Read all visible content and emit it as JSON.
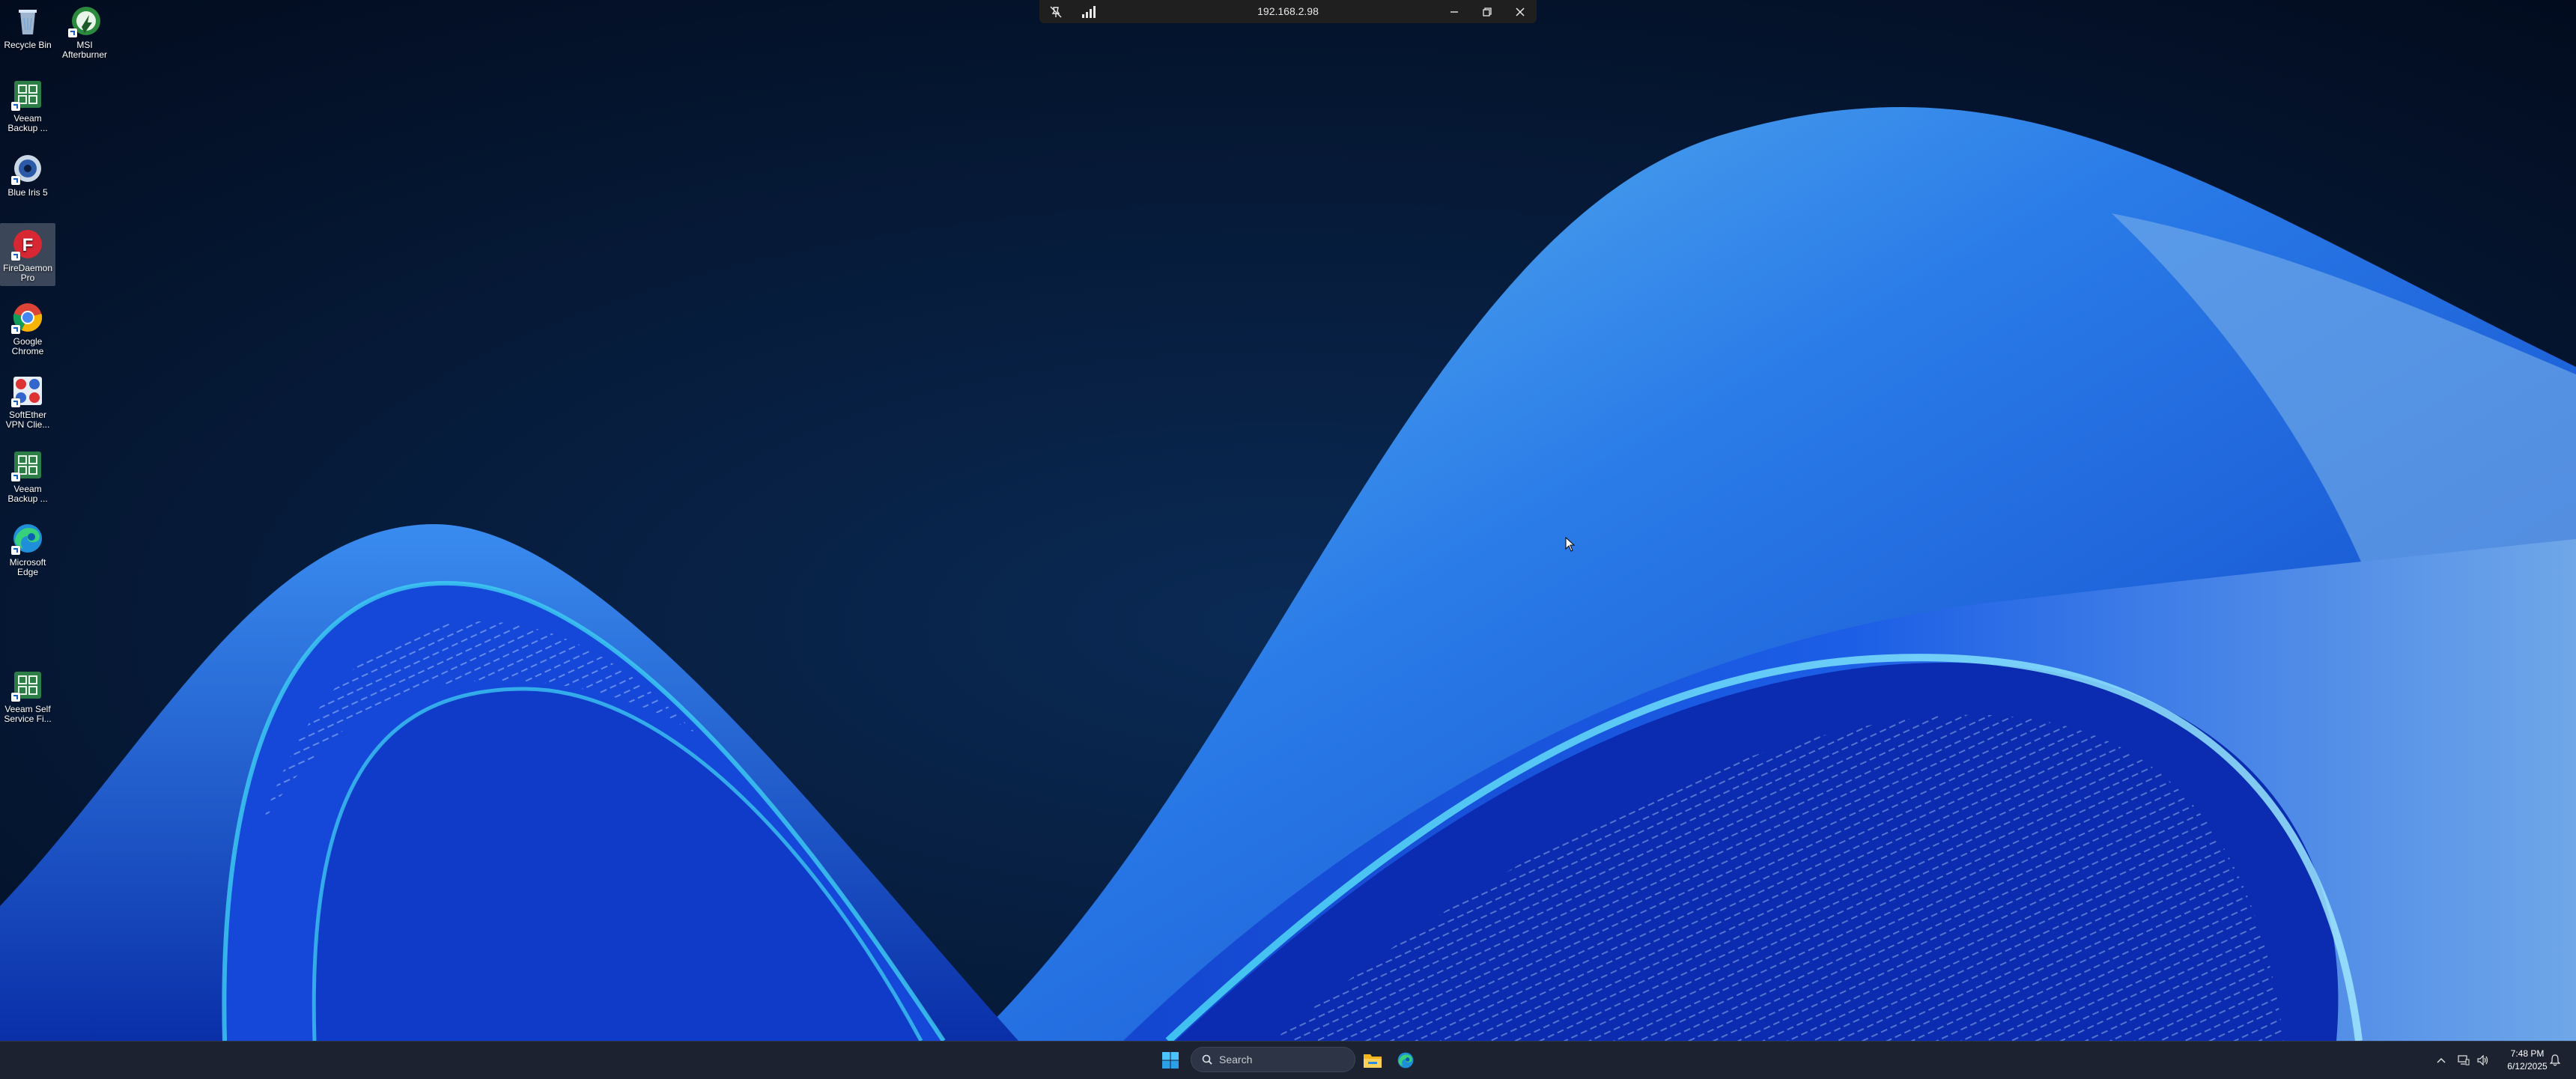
{
  "remote_bar": {
    "address": "192.168.2.98"
  },
  "desktop_icons": [
    {
      "label": "Recycle Bin",
      "icon": "recycle-bin-icon"
    },
    {
      "label": "MSI Afterburner",
      "icon": "msi-afterburner-icon"
    },
    {
      "label": "Veeam Backup ...",
      "icon": "veeam-icon"
    },
    {
      "label": "Blue Iris 5",
      "icon": "blue-iris-icon"
    },
    {
      "label": "FireDaemon Pro",
      "icon": "firedaemon-icon"
    },
    {
      "label": "Google Chrome",
      "icon": "chrome-icon"
    },
    {
      "label": "SoftEther VPN Clie...",
      "icon": "softether-icon"
    },
    {
      "label": "Veeam Backup ...",
      "icon": "veeam-icon"
    },
    {
      "label": "Microsoft Edge",
      "icon": "edge-icon"
    },
    {
      "label": "Veeam Self Service Fi...",
      "icon": "veeam-icon"
    }
  ],
  "taskbar": {
    "search_placeholder": "Search",
    "pinned": [
      "start-icon",
      "file-explorer-icon",
      "edge-icon"
    ]
  },
  "tray": {
    "time": "7:48 PM",
    "date": "6/12/2025"
  },
  "colors": {
    "background": "#04122a",
    "wave_blue": "#1a5fe0",
    "wave_cyan": "#4ec3f0",
    "taskbar": "#1c2230"
  }
}
